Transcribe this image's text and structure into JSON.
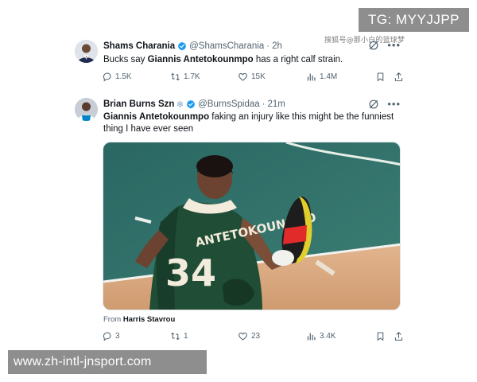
{
  "overlays": {
    "telegram": "TG: MYYJJPP",
    "website": "www.zh-intl-jnsport.com",
    "watermark": "搜狐号@那小白的篮球梦"
  },
  "tweets": [
    {
      "author_name": "Shams Charania",
      "handle": "@ShamsCharania",
      "separator": "·",
      "time": "2h",
      "text_before": "Bucks say ",
      "mention": "Giannis Antetokounmpo",
      "text_after": " has a right calf strain.",
      "stats": {
        "replies": "1.5K",
        "reposts": "1.7K",
        "likes": "15K",
        "views": "1.4M"
      }
    },
    {
      "author_name": "Brian Burns Szn",
      "name_emoji": "❄",
      "handle": "@BurnsSpidaa",
      "separator": "·",
      "time": "21m",
      "mention": "Giannis Antetokounmpo",
      "text_after": " faking an injury like this might be the funniest thing I have ever seen",
      "media": {
        "jersey_name": "ANTETOKOUNMPO",
        "jersey_number": "34"
      },
      "from_label": "From",
      "from_name": "Harris Stavrou",
      "stats": {
        "replies": "3",
        "reposts": "1",
        "likes": "23",
        "views": "3.4K"
      }
    }
  ],
  "icons": [
    "verified-icon",
    "grok-icon",
    "more-icon",
    "reply-icon",
    "repost-icon",
    "like-icon",
    "views-icon",
    "bookmark-icon",
    "share-icon"
  ],
  "colors": {
    "verified": "#1d9bf0",
    "text": "#0f1419",
    "muted": "#536471",
    "court": "#2f6f6a",
    "floor": "#d9a77c",
    "jersey": "#1f4d35"
  }
}
